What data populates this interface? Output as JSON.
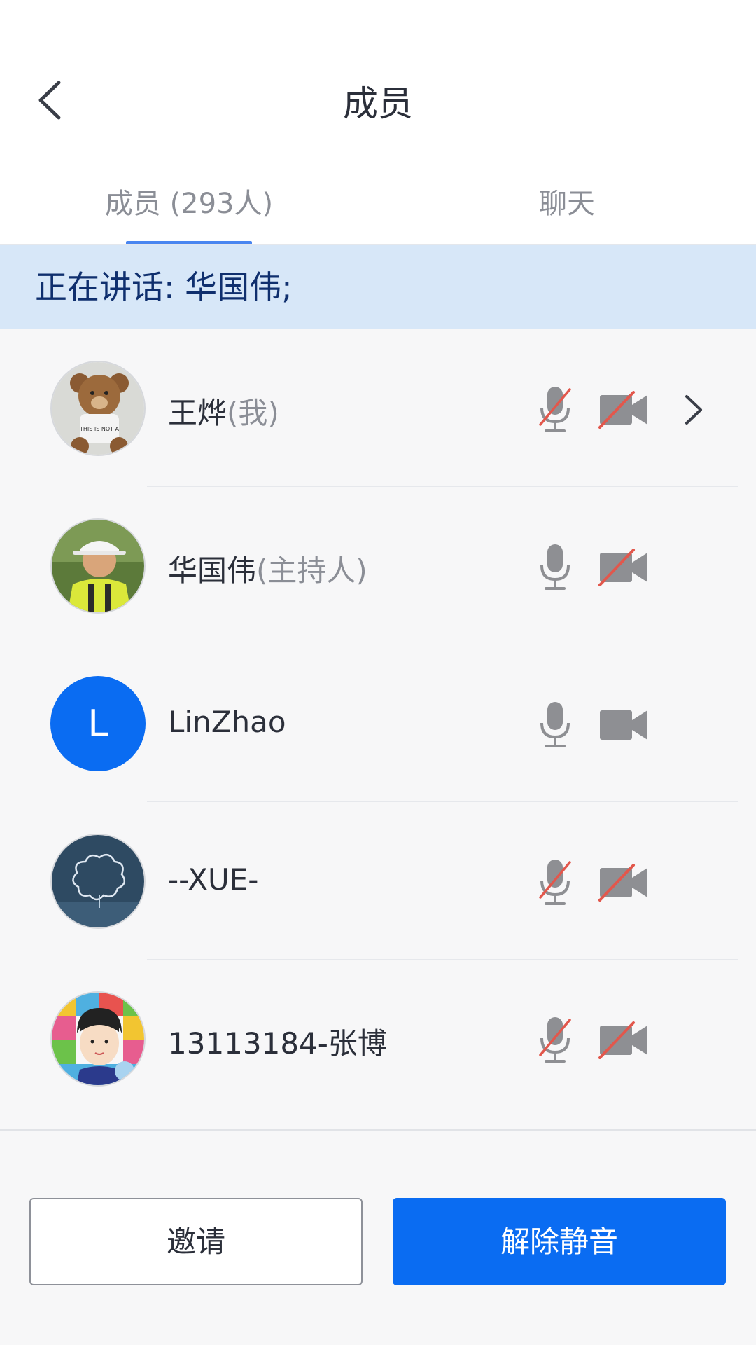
{
  "header": {
    "title": "成员"
  },
  "tabs": [
    {
      "label": "成员 (293人)",
      "active": true
    },
    {
      "label": "聊天",
      "active": false
    }
  ],
  "speaking": {
    "text": "正在讲话: 华国伟;"
  },
  "members": [
    {
      "name": "王烨",
      "role": "(我)",
      "avatar": "teddy-bear",
      "mic_muted": true,
      "camera_off": true,
      "has_chevron": true
    },
    {
      "name": "华国伟",
      "role": "(主持人)",
      "avatar": "man-outdoors-photo",
      "mic_muted": false,
      "camera_off": true,
      "has_chevron": false
    },
    {
      "name": "LinZhao",
      "role": "",
      "avatar_letter": "L",
      "mic_muted": false,
      "camera_off": false,
      "has_chevron": false
    },
    {
      "name": "--XUE-",
      "role": "",
      "avatar": "cloud-sculpture-photo",
      "mic_muted": true,
      "camera_off": true,
      "has_chevron": false
    },
    {
      "name": "13113184-张博",
      "role": "",
      "avatar": "cartoon-boy",
      "mic_muted": true,
      "camera_off": true,
      "has_chevron": false
    }
  ],
  "buttons": {
    "invite": "邀请",
    "unmute": "解除静音"
  },
  "colors": {
    "accent": "#0a6cf2",
    "speaking_bg": "#d7e7f8",
    "muted_slash": "#e2574c",
    "icon_gray": "#8e8f93"
  }
}
